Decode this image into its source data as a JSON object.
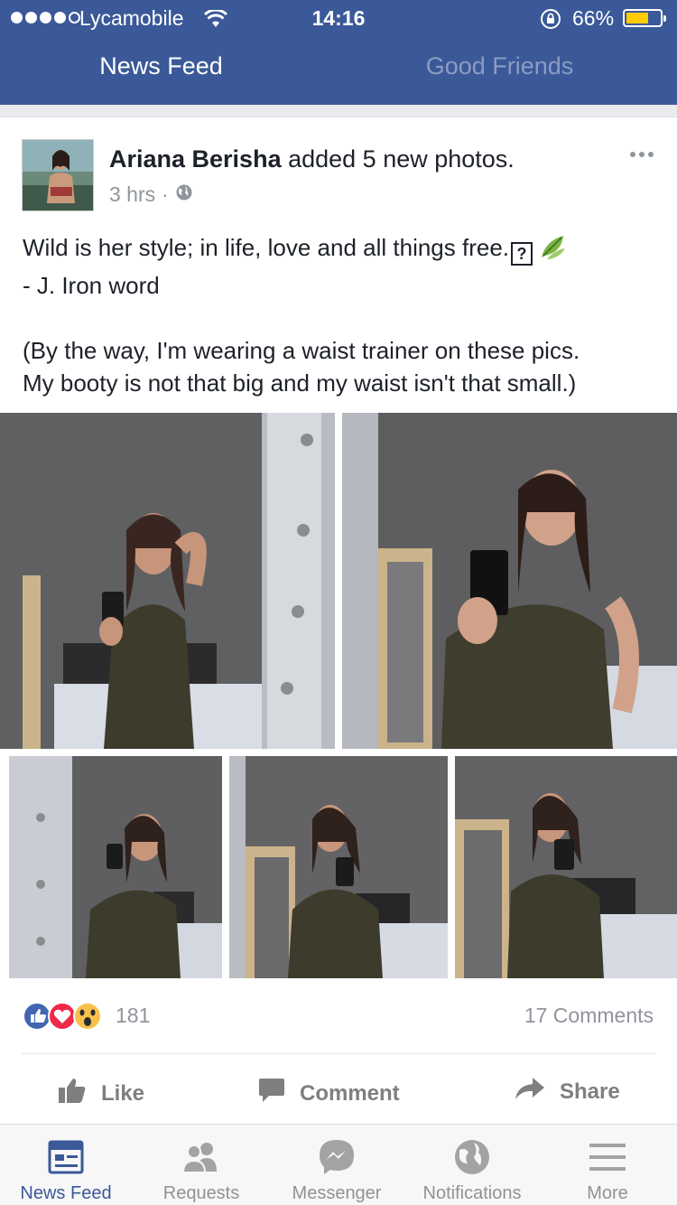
{
  "status_bar": {
    "carrier": "Lycamobile",
    "time": "14:16",
    "battery_percent": "66%",
    "battery_level": 0.66,
    "signal_bars": 4
  },
  "top_nav": {
    "active_tab": "News Feed",
    "inactive_tab": "Good Friends"
  },
  "post": {
    "author": "Ariana Berisha",
    "action": " added 5 new photos.",
    "time_ago": "3 hrs",
    "meta_sep": "·",
    "privacy_icon": "globe-icon",
    "text_line1": "Wild is her style; in life, love and all things free.",
    "text_symbol": "?",
    "text_line2": "- J. Iron word",
    "text_line3": "(By the way, I'm wearing a waist trainer on these pics.",
    "text_line4": "My booty is not that big and my waist isn't that small.)",
    "photo_count": 5
  },
  "reactions": {
    "icons": [
      "like-reaction-icon",
      "love-reaction-icon",
      "wow-reaction-icon"
    ],
    "count": "181",
    "comments": "17 Comments"
  },
  "actions": {
    "like": "Like",
    "comment": "Comment",
    "share": "Share"
  },
  "tabbar": {
    "items": [
      {
        "label": "News Feed",
        "icon": "news-feed-icon",
        "active": true
      },
      {
        "label": "Requests",
        "icon": "friend-requests-icon",
        "active": false
      },
      {
        "label": "Messenger",
        "icon": "messenger-icon",
        "active": false
      },
      {
        "label": "Notifications",
        "icon": "globe-icon",
        "active": false
      },
      {
        "label": "More",
        "icon": "menu-icon",
        "active": false
      }
    ]
  },
  "colors": {
    "brand": "#3b5998",
    "inactive_tab_text": "#8b9dc3",
    "meta_gray": "#90949c",
    "battery": "#ffcc00",
    "like_blue": "#4267b2",
    "love_red": "#f0284a",
    "wow_yellow": "#f7c04a"
  }
}
